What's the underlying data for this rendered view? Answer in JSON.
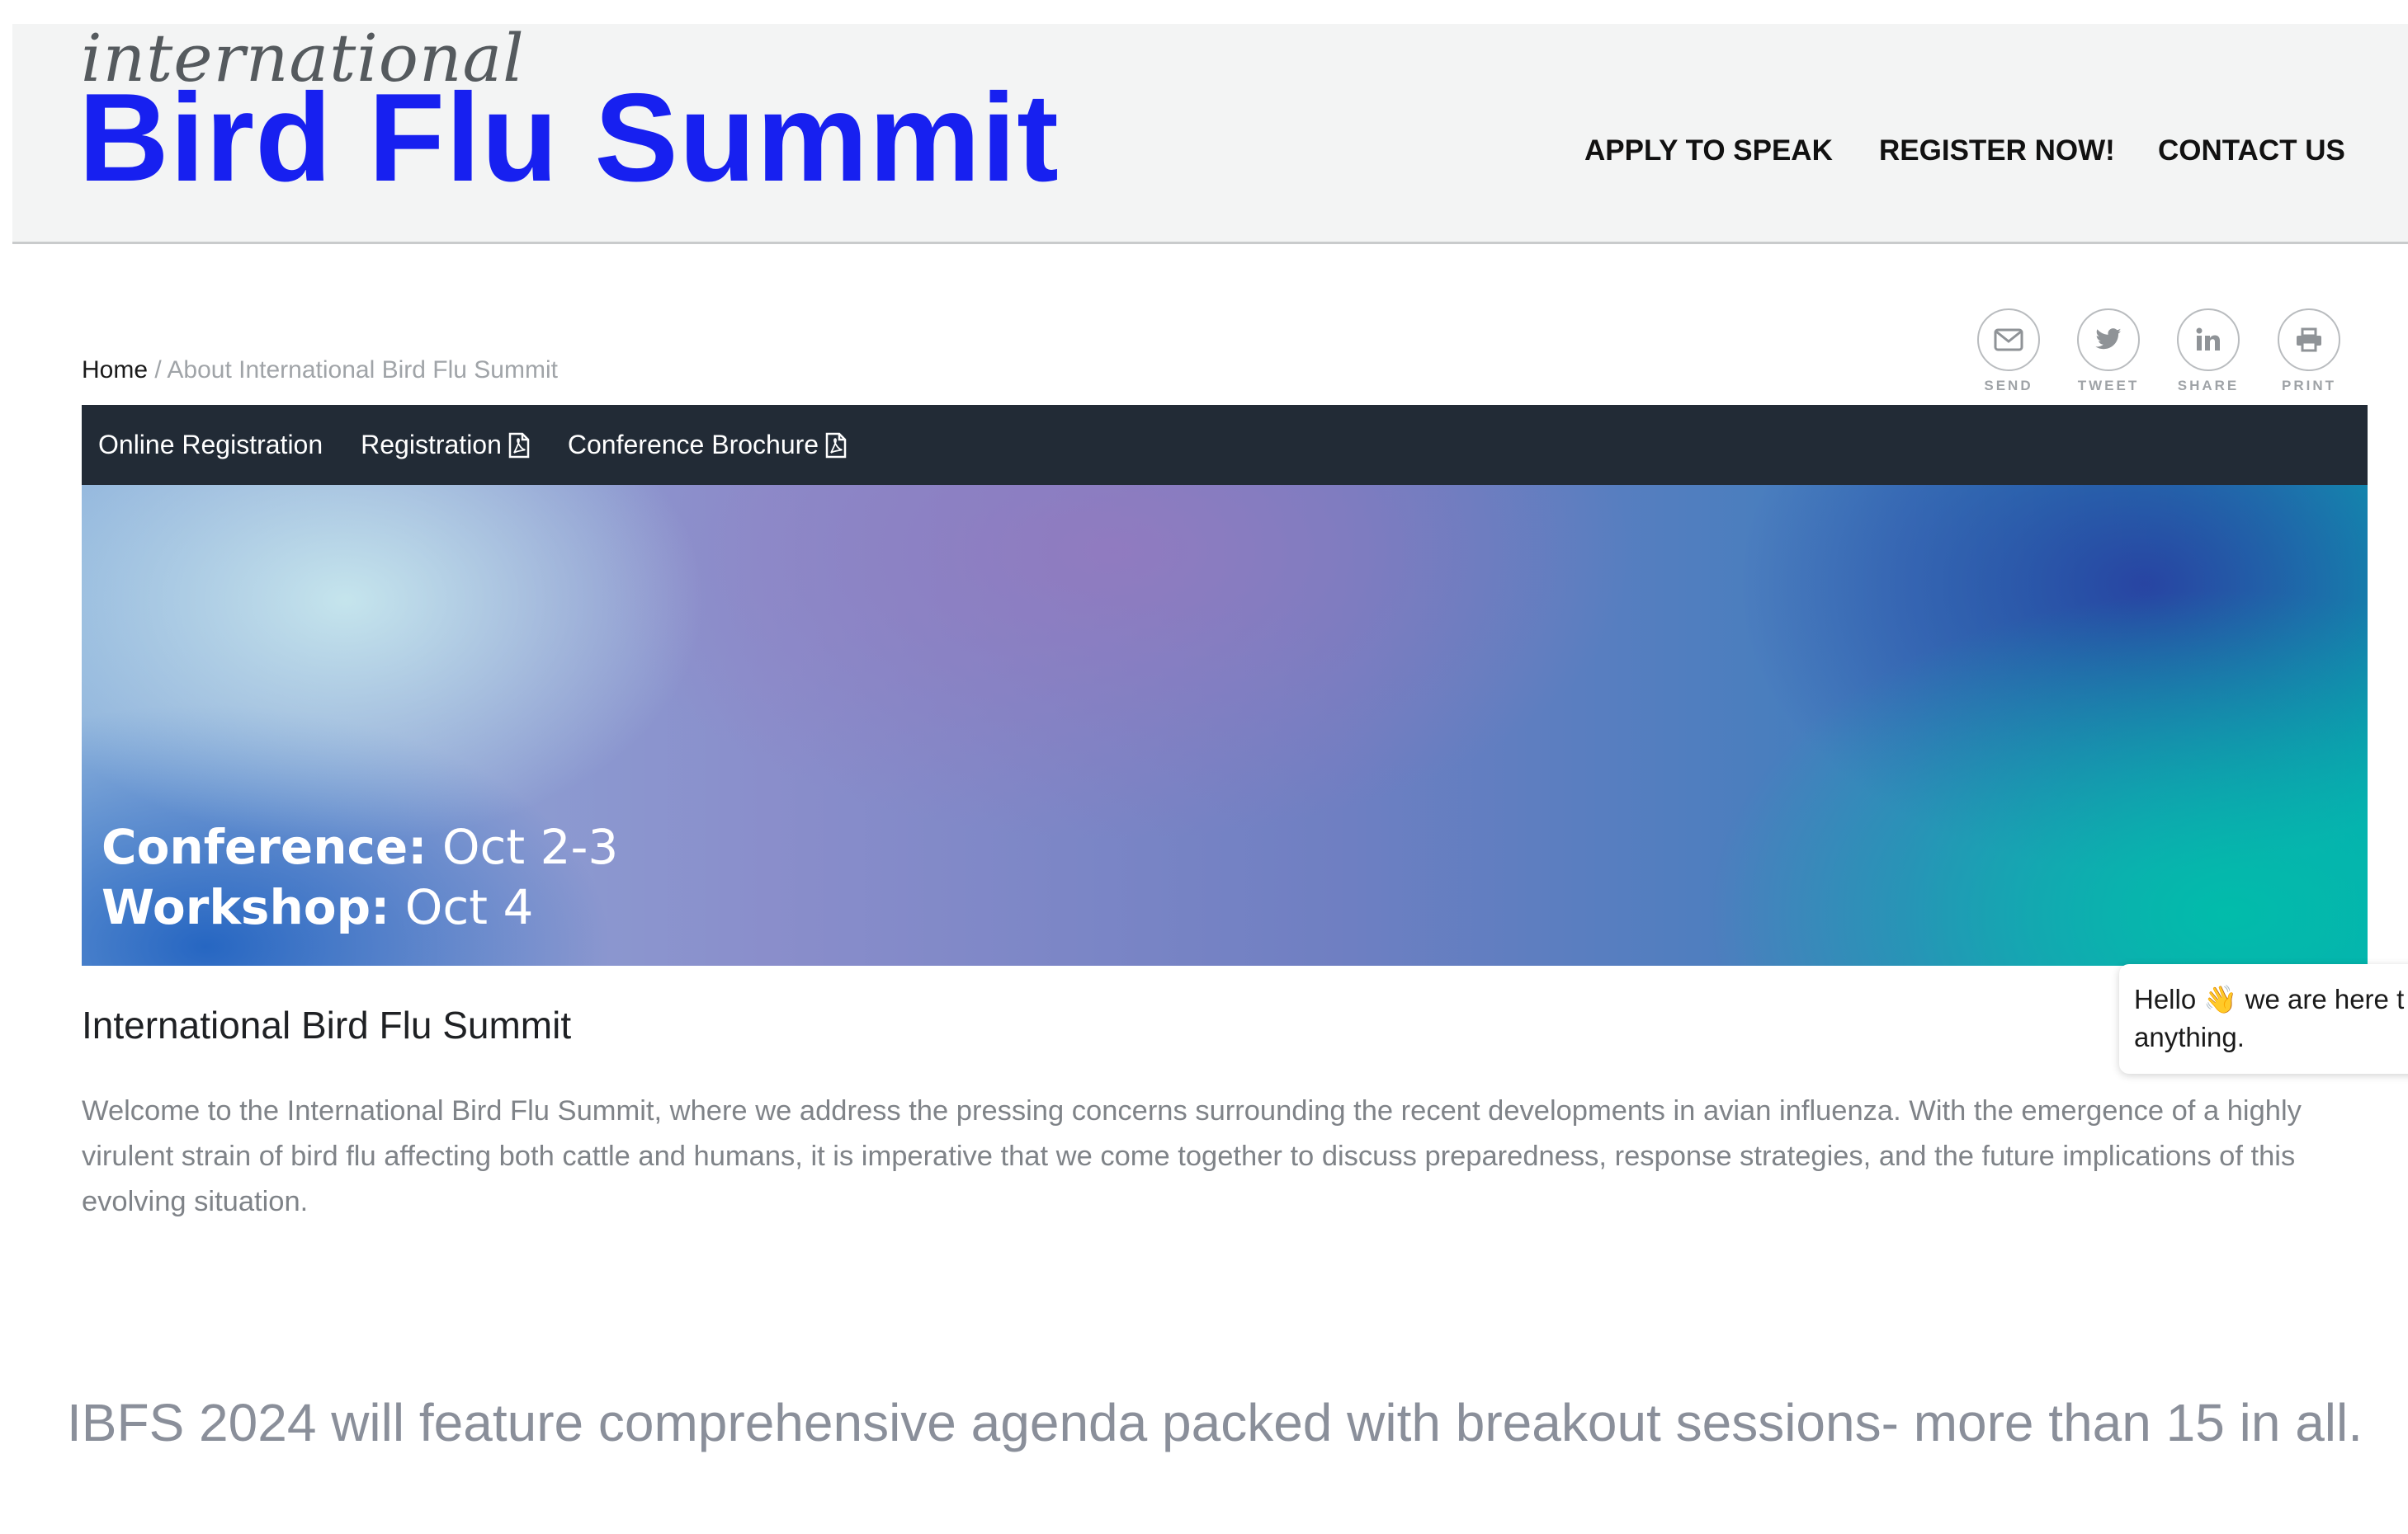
{
  "header": {
    "logo_small": "international",
    "logo_big": "Bird Flu Summit",
    "nav": [
      "APPLY TO SPEAK",
      "REGISTER NOW!",
      "CONTACT US"
    ]
  },
  "breadcrumb": {
    "home": "Home",
    "separator": " / ",
    "current": "About International Bird Flu Summit"
  },
  "share": [
    {
      "label": "SEND",
      "icon": "envelope-icon"
    },
    {
      "label": "TWEET",
      "icon": "twitter-icon"
    },
    {
      "label": "SHARE",
      "icon": "linkedin-icon"
    },
    {
      "label": "PRINT",
      "icon": "printer-icon"
    }
  ],
  "subnav": {
    "items": [
      {
        "label": "Online Registration"
      },
      {
        "label": "Registration",
        "icon": "pdf-icon"
      },
      {
        "label": "Conference Brochure",
        "icon": "pdf-icon"
      }
    ]
  },
  "hero": {
    "conference_label": "Conference:",
    "conference_dates": " Oct 2-3",
    "workshop_label": "Workshop:",
    "workshop_dates": " Oct 4"
  },
  "main": {
    "title": "International Bird Flu Summit",
    "intro": "Welcome to the International Bird Flu Summit, where we address the pressing concerns surrounding the recent developments in avian influenza. With the emergence of a highly virulent strain of bird flu affecting both cattle and humans, it is imperative that we come together to discuss preparedness, response strategies, and the future implications of this evolving situation.",
    "tagline": "IBFS 2024 will feature comprehensive agenda packed with breakout sessions- more than 15 in all."
  },
  "chat": {
    "line1_start": "Hello ",
    "emoji": "👋",
    "line1_end": " we are here t",
    "line2": "anything."
  },
  "colors": {
    "brand_blue": "#1720f0",
    "subnav_bg": "#222b36",
    "header_bg": "#f3f4f4"
  }
}
